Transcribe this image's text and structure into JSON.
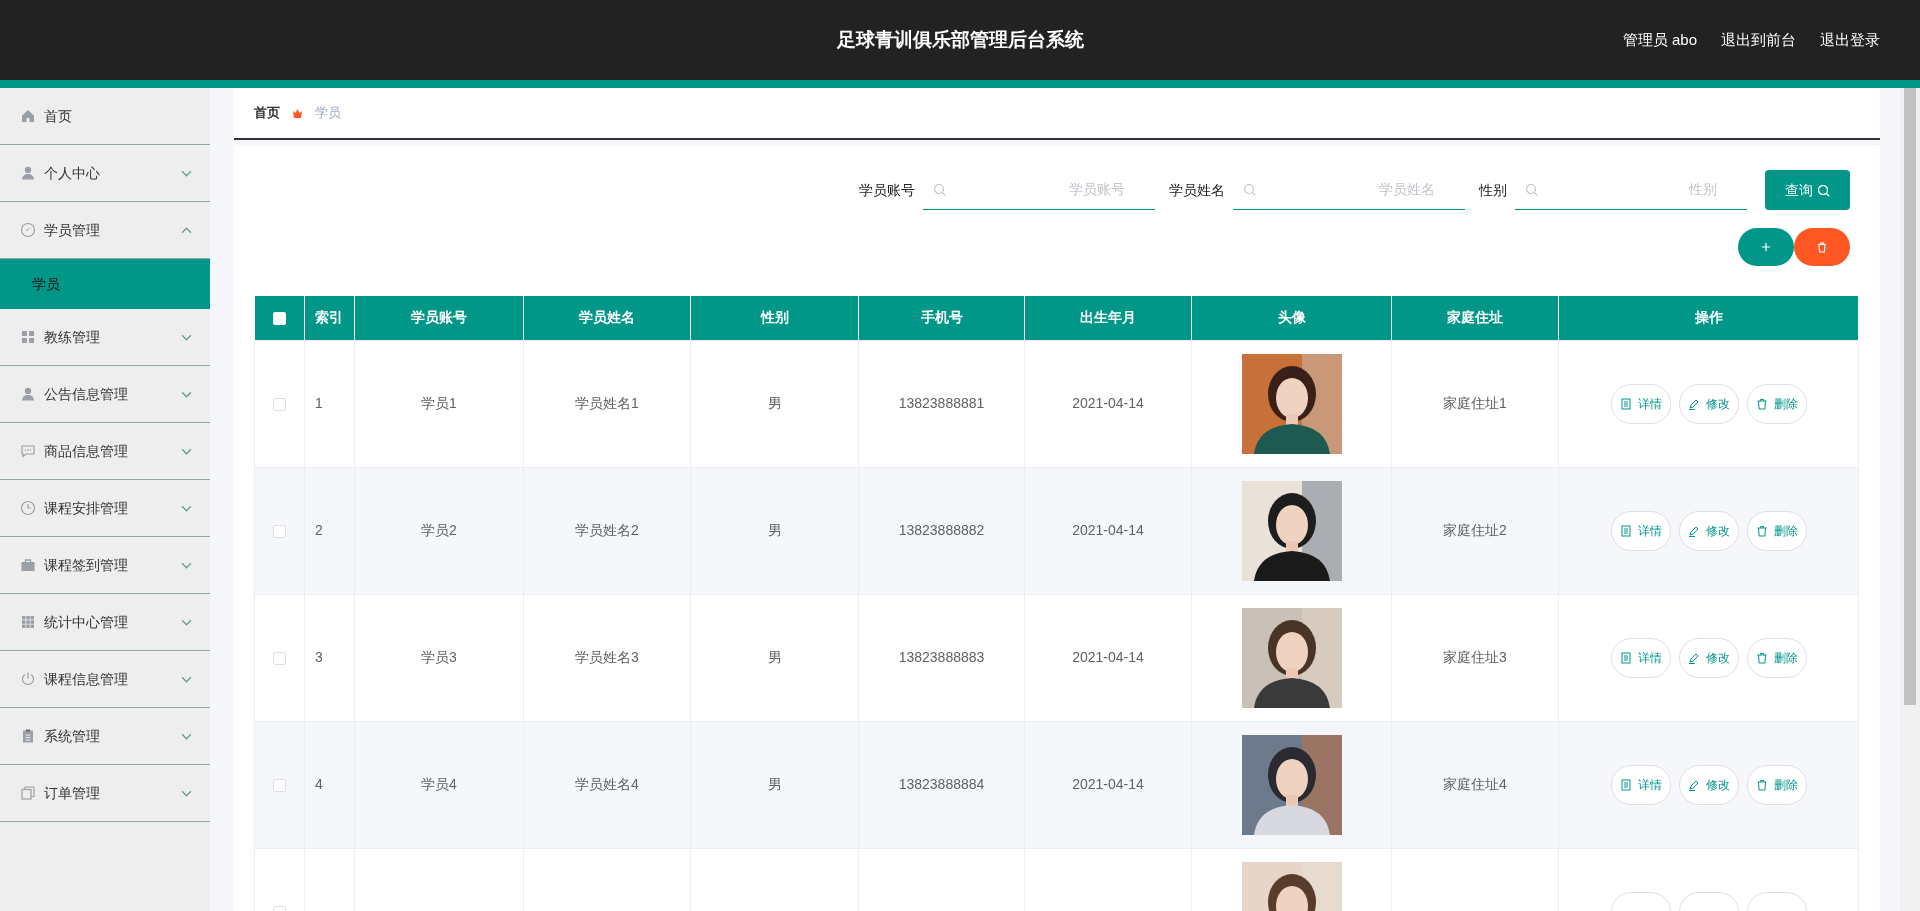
{
  "header": {
    "title": "足球青训俱乐部管理后台系统",
    "links": [
      "管理员 abo",
      "退出到前台",
      "退出登录"
    ]
  },
  "sidebar": {
    "items": [
      {
        "label": "首页",
        "kind": "link"
      },
      {
        "label": "个人中心",
        "kind": "menu",
        "expanded": false
      },
      {
        "label": "学员管理",
        "kind": "menu",
        "expanded": true,
        "children": [
          {
            "label": "学员",
            "selected": true
          }
        ]
      },
      {
        "label": "教练管理",
        "kind": "menu",
        "expanded": false
      },
      {
        "label": "公告信息管理",
        "kind": "menu",
        "expanded": false
      },
      {
        "label": "商品信息管理",
        "kind": "menu",
        "expanded": false
      },
      {
        "label": "课程安排管理",
        "kind": "menu",
        "expanded": false
      },
      {
        "label": "课程签到管理",
        "kind": "menu",
        "expanded": false
      },
      {
        "label": "统计中心管理",
        "kind": "menu",
        "expanded": false
      },
      {
        "label": "课程信息管理",
        "kind": "menu",
        "expanded": false
      },
      {
        "label": "系统管理",
        "kind": "menu",
        "expanded": false
      },
      {
        "label": "订单管理",
        "kind": "menu",
        "expanded": false
      }
    ]
  },
  "breadcrumb": [
    "首页",
    "学员"
  ],
  "search": {
    "fields": [
      {
        "label": "学员账号",
        "placeholder": "学员账号"
      },
      {
        "label": "学员姓名",
        "placeholder": "学员姓名"
      },
      {
        "label": "性别",
        "placeholder": "性别"
      }
    ],
    "button": "查询"
  },
  "table": {
    "select_all_checked": false,
    "columns": [
      "索引",
      "学员账号",
      "学员姓名",
      "性别",
      "手机号",
      "出生年月",
      "头像",
      "家庭住址",
      "操作"
    ],
    "rows": [
      {
        "checked": false,
        "cells": [
          "1",
          "学员1",
          "学员姓名1",
          "男",
          "13823888881",
          "2021-04-14",
          "家庭住址1"
        ],
        "actions": [
          "详情",
          "修改",
          "删除"
        ]
      },
      {
        "checked": false,
        "cells": [
          "2",
          "学员2",
          "学员姓名2",
          "男",
          "13823888882",
          "2021-04-14",
          "家庭住址2"
        ],
        "actions": [
          "详情",
          "修改",
          "删除"
        ]
      },
      {
        "checked": false,
        "cells": [
          "3",
          "学员3",
          "学员姓名3",
          "男",
          "13823888883",
          "2021-04-14",
          "家庭住址3"
        ],
        "actions": [
          "详情",
          "修改",
          "删除"
        ]
      },
      {
        "checked": false,
        "cells": [
          "4",
          "学员4",
          "学员姓名4",
          "男",
          "13823888884",
          "2021-04-14",
          "家庭住址4"
        ],
        "actions": [
          "详情",
          "修改",
          "删除"
        ]
      },
      {
        "checked": false
      }
    ]
  }
}
